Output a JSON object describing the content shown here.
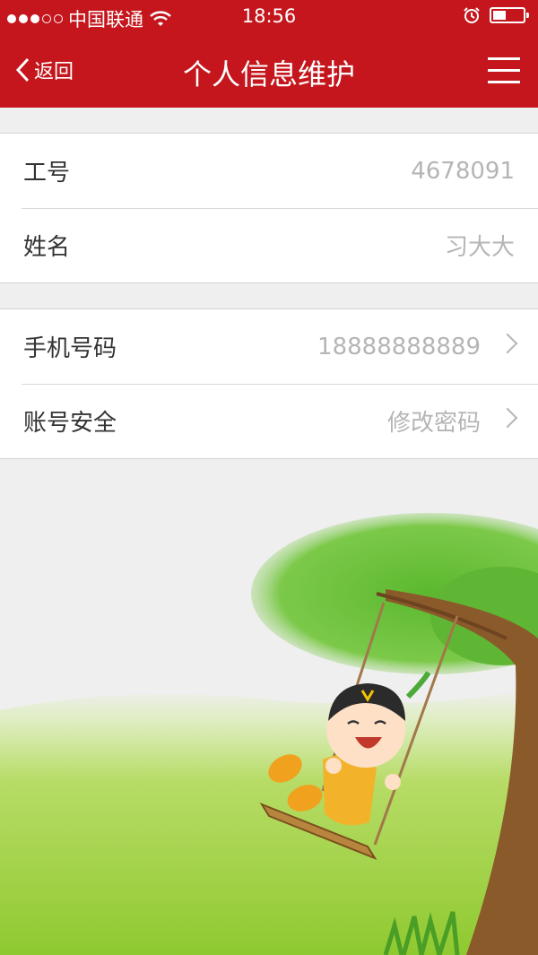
{
  "status_bar": {
    "carrier": "中国联通",
    "time": "18:56",
    "wifi_icon": "wifi-icon",
    "alarm_icon": "alarm-icon",
    "battery_level": 0.45
  },
  "nav": {
    "back_label": "返回",
    "title": "个人信息维护",
    "menu_icon": "menu-icon",
    "bar_color": "#c4161c"
  },
  "info_group": [
    {
      "label": "工号",
      "value": "4678091"
    },
    {
      "label": "姓名",
      "value": "习大大"
    }
  ],
  "action_group": [
    {
      "label": "手机号码",
      "value": "18888888889"
    },
    {
      "label": "账号安全",
      "value": "修改密码"
    }
  ],
  "illustration": {
    "icon": "swing-boy-illustration"
  }
}
